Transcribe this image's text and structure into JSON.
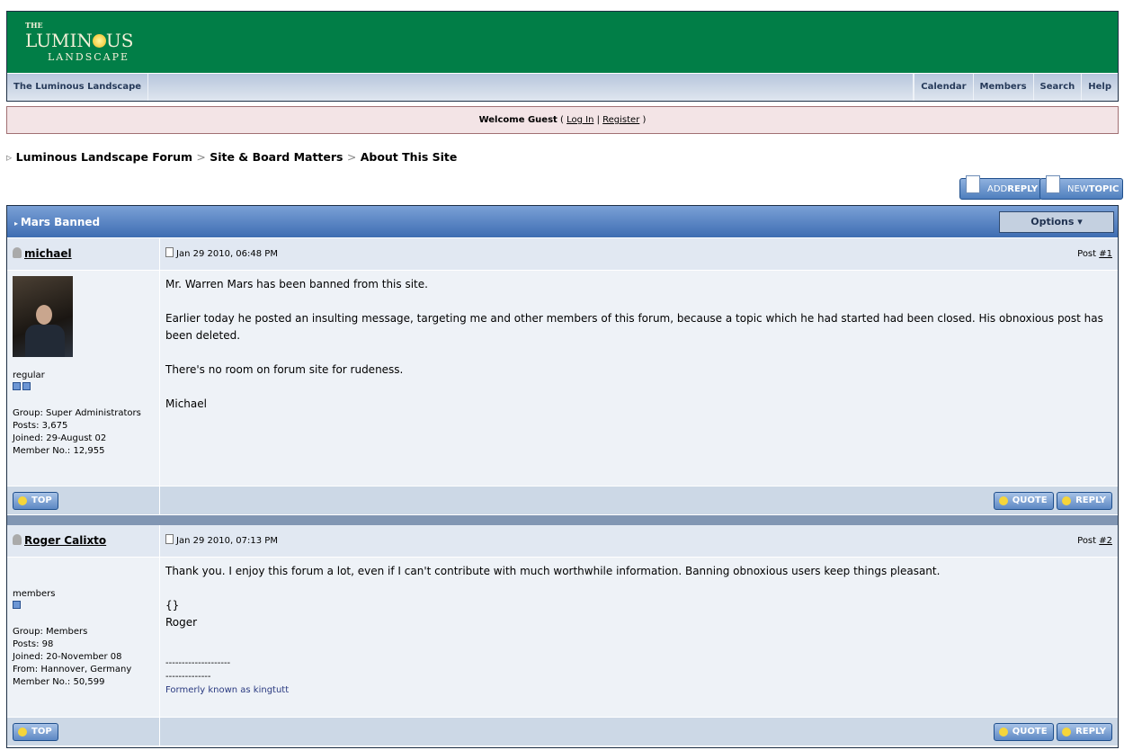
{
  "logo": {
    "the": "THE",
    "luminous_a": "LUMIN",
    "luminous_b": "US",
    "landscape": "LANDSCAPE"
  },
  "nav": {
    "home": "The Luminous Landscape",
    "items": [
      "Calendar",
      "Members",
      "Search",
      "Help"
    ]
  },
  "welcome": {
    "text": "Welcome Guest",
    "open": " ( ",
    "login": "Log In",
    "pipe": " | ",
    "register": "Register",
    "close": " )"
  },
  "breadcrumb": [
    "Luminous Landscape Forum",
    "Site & Board Matters",
    "About This Site"
  ],
  "breadcrumb_sep": ">",
  "buttons": {
    "add_reply_a": "ADD",
    "add_reply_b": "REPLY",
    "new_topic_a": "NEW",
    "new_topic_b": "TOPIC",
    "options": "Options ▾",
    "top": "TOP",
    "quote": "QUOTE",
    "reply": "REPLY"
  },
  "topic": {
    "title": "Mars Banned"
  },
  "posts": [
    {
      "author": "michael",
      "date": "Jan 29 2010, 06:48 PM",
      "post_label": "Post ",
      "post_num": "#1",
      "rank": "regular",
      "group": "Group: Super Administrators",
      "posts": "Posts: 3,675",
      "joined": "Joined: 29-August 02",
      "member_no": "Member No.: 12,955",
      "body": [
        "Mr. Warren Mars has been banned from this site.",
        "Earlier today he posted an insulting message, targeting me and other members of this forum, because a topic which he had started had been closed. His obnoxious post has been deleted.",
        "There's no room on forum site for rudeness.",
        "Michael"
      ]
    },
    {
      "author": "Roger Calixto",
      "date": "Jan 29 2010, 07:13 PM",
      "post_label": "Post ",
      "post_num": "#2",
      "rank": "members",
      "group": "Group: Members",
      "posts": "Posts: 98",
      "joined": "Joined: 20-November 08",
      "from": "From: Hannover, Germany",
      "member_no": "Member No.: 50,599",
      "body": [
        "Thank you. I enjoy this forum a lot, even if I can't contribute with much worthwhile information. Banning obnoxious users keep things pleasant.",
        "{}",
        "Roger"
      ],
      "sig": [
        "--------------------",
        "--------------",
        "Formerly known as kingtutt"
      ]
    }
  ]
}
